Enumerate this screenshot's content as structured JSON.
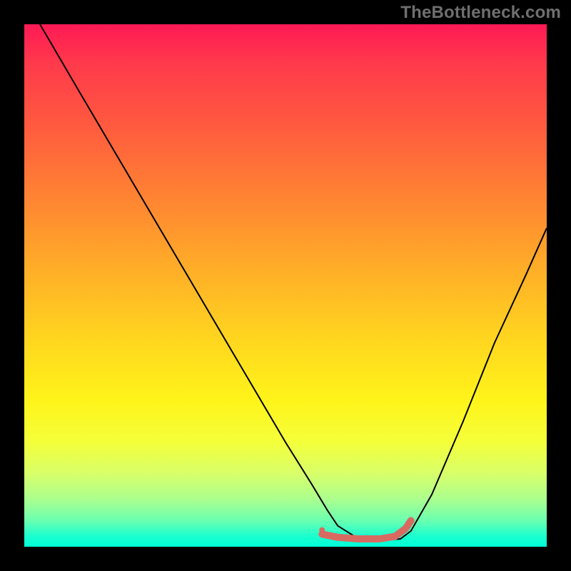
{
  "watermark": "TheBottleneck.com",
  "chart_data": {
    "type": "line",
    "title": "",
    "xlabel": "",
    "ylabel": "",
    "xlim": [
      0,
      100
    ],
    "ylim": [
      0,
      100
    ],
    "grid": false,
    "legend": false,
    "background": "rainbow-gradient (red top → green bottom)",
    "series": [
      {
        "name": "curve",
        "color": "#000000",
        "stroke_width": 2,
        "x": [
          3,
          10,
          20,
          30,
          40,
          50,
          55,
          58,
          60,
          64,
          68,
          72,
          74,
          78,
          84,
          90,
          96,
          100
        ],
        "values": [
          100,
          88,
          71,
          54,
          37,
          20,
          12,
          7,
          4,
          1.5,
          1.2,
          1.5,
          3,
          10,
          24,
          39,
          52,
          61
        ]
      },
      {
        "name": "floor-marker",
        "color": "#d86a62",
        "stroke_width": 10,
        "linecap": "round",
        "x": [
          57,
          60,
          64,
          68,
          71,
          73,
          74
        ],
        "values": [
          2.4,
          1.8,
          1.5,
          1.5,
          2.0,
          3.5,
          5.0
        ]
      }
    ],
    "points": [
      {
        "name": "min-dot",
        "x": 57,
        "y": 3.2,
        "r": 4,
        "color": "#d86a62"
      }
    ]
  }
}
